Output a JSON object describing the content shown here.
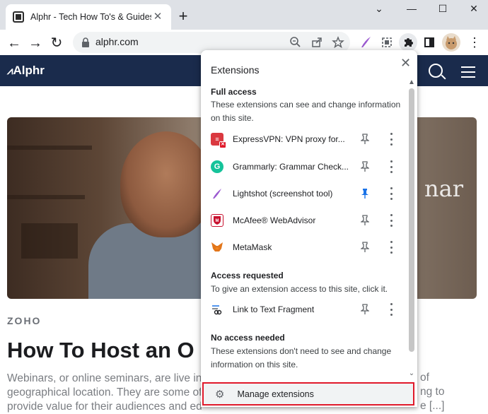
{
  "tab": {
    "title": "Alphr - Tech How To's & Guides",
    "close": "✕",
    "new_tab": "+"
  },
  "window_controls": {
    "minimize": "—",
    "maximize": "☐",
    "close": "✕",
    "tabsearch": "⌄"
  },
  "toolbar": {
    "url": "alphr.com",
    "back": "←",
    "forward": "→",
    "reload": "↻"
  },
  "site": {
    "logo": "Alphr",
    "brand": "ZOHO",
    "hero_overlay_text": "nar",
    "title": "How To Host an O",
    "body_lines": [
      "Webinars, or online seminars, are live int",
      "geographical location. They are some of",
      "provide value for their audiences and ed"
    ],
    "right_fragments": [
      "of",
      "ng to",
      "e [...]"
    ]
  },
  "popup": {
    "title": "Extensions",
    "close": "✕",
    "full_access": {
      "heading": "Full access",
      "desc_line1": "These extensions can see and change information",
      "desc_line2": "on this site.",
      "items": [
        {
          "name": "ExpressVPN: VPN proxy for...",
          "pinned": false
        },
        {
          "name": "Grammarly: Grammar Check...",
          "pinned": false
        },
        {
          "name": "Lightshot (screenshot tool)",
          "pinned": true
        },
        {
          "name": "McAfee® WebAdvisor",
          "pinned": false
        },
        {
          "name": "MetaMask",
          "pinned": false
        }
      ]
    },
    "access_requested": {
      "heading": "Access requested",
      "desc_line1": "To give an extension access to this site, click it.",
      "items": [
        {
          "name": "Link to Text Fragment",
          "pinned": false
        }
      ]
    },
    "no_access": {
      "heading": "No access needed",
      "desc_line1": "These extensions don't need to see and change",
      "desc_line2": "information on this site."
    },
    "manage_label": "Manage extensions"
  },
  "colors": {
    "header_bg": "#1a2b4c",
    "pin_active": "#1a73e8",
    "highlight_border": "#e0192a"
  }
}
